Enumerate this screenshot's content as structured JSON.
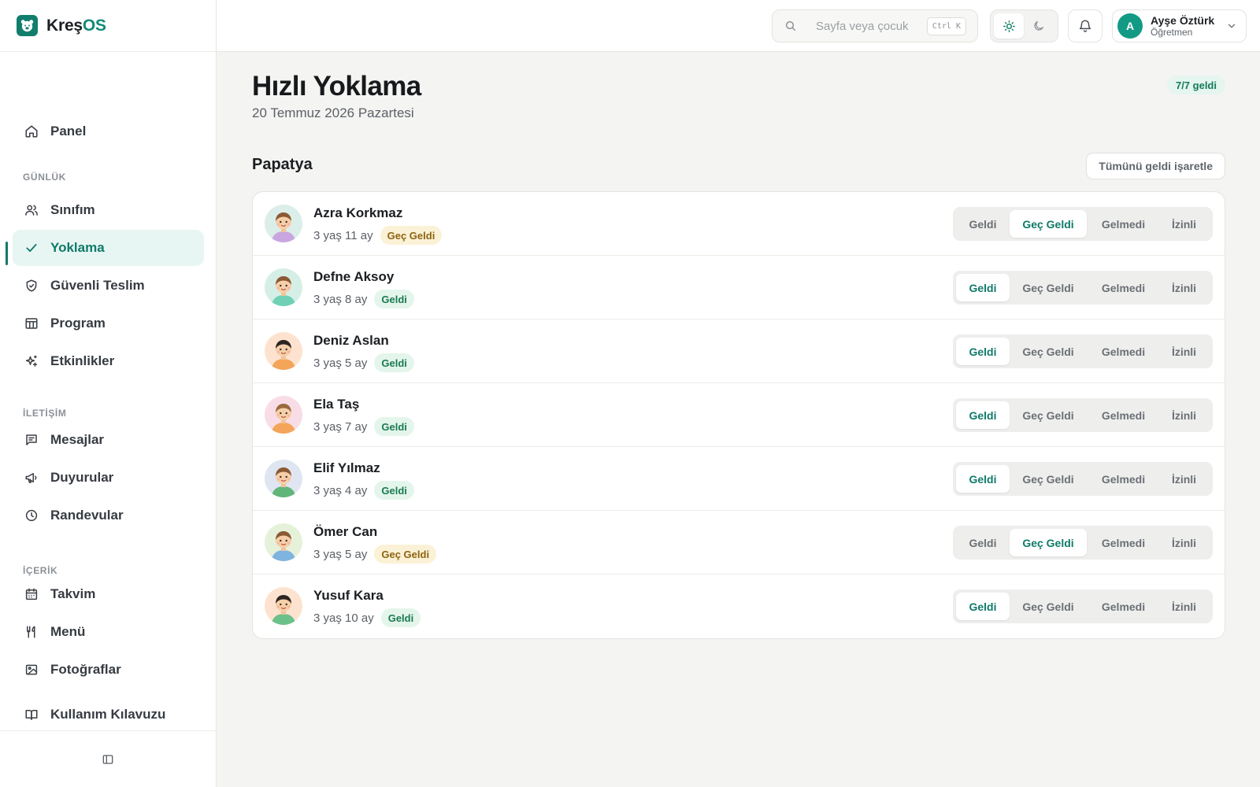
{
  "brand": {
    "name_main": "Kreş",
    "name_accent": "OS",
    "logo_icon": "bear-logo-icon",
    "accent_color": "#117e6d"
  },
  "sidebar": {
    "items": [
      {
        "id": "panel",
        "label": "Panel",
        "icon": "home-icon"
      },
      {
        "id": "sinifim",
        "label": "Sınıfım",
        "icon": "users-icon"
      },
      {
        "id": "yoklama",
        "label": "Yoklama",
        "icon": "check-icon",
        "active": true
      },
      {
        "id": "guvenli-teslim",
        "label": "Güvenli Teslim",
        "icon": "shield-check-icon"
      },
      {
        "id": "program",
        "label": "Program",
        "icon": "table-icon"
      },
      {
        "id": "etkinlikler",
        "label": "Etkinlikler",
        "icon": "sparkle-icon"
      },
      {
        "id": "mesajlar",
        "label": "Mesajlar",
        "icon": "message-icon"
      },
      {
        "id": "duyurular",
        "label": "Duyurular",
        "icon": "megaphone-icon"
      },
      {
        "id": "randevular",
        "label": "Randevular",
        "icon": "clock-icon"
      },
      {
        "id": "takvim",
        "label": "Takvim",
        "icon": "calendar-icon"
      },
      {
        "id": "menu",
        "label": "Menü",
        "icon": "utensils-icon"
      },
      {
        "id": "fotograflar",
        "label": "Fotoğraflar",
        "icon": "image-icon"
      },
      {
        "id": "kilavuz",
        "label": "Kullanım Kılavuzu",
        "icon": "book-icon"
      }
    ],
    "sections": [
      "GÜNLÜK",
      "İLETİŞİM",
      "İÇERİK"
    ],
    "collapse_icon": "sidebar-toggle-icon"
  },
  "topbar": {
    "search_placeholder": "Sayfa veya çocuk",
    "search_shortcut": "Ctrl K",
    "theme": {
      "light_icon": "sun-icon",
      "dark_icon": "moon-icon",
      "selected": "light"
    },
    "notification_icon": "bell-icon",
    "user": {
      "initial": "A",
      "name": "Ayşe Öztürk",
      "role": "Öğretmen"
    }
  },
  "page": {
    "title": "Hızlı Yoklama",
    "date": "20 Temmuz 2026 Pazartesi",
    "summary": "7/7 geldi",
    "class_name": "Papatya",
    "mark_all_label": "Tümünü geldi işaretle"
  },
  "options": [
    "Geldi",
    "Geç Geldi",
    "Gelmedi",
    "İzinli"
  ],
  "children": [
    {
      "name": "Azra Korkmaz",
      "age": "3 yaş 11 ay",
      "status": "Geç Geldi",
      "selected": 1,
      "avatar_bg": "#dbeee9",
      "hair": "#8a5a35",
      "shirt": "#c9a6e0"
    },
    {
      "name": "Defne Aksoy",
      "age": "3 yaş 8 ay",
      "status": "Geldi",
      "selected": 0,
      "avatar_bg": "#d6efe6",
      "hair": "#8a5a35",
      "shirt": "#6fd0b5"
    },
    {
      "name": "Deniz Aslan",
      "age": "3 yaş 5 ay",
      "status": "Geldi",
      "selected": 0,
      "avatar_bg": "#fde3cf",
      "hair": "#2e2520",
      "shirt": "#f3a55a"
    },
    {
      "name": "Ela Taş",
      "age": "3 yaş 7 ay",
      "status": "Geldi",
      "selected": 0,
      "avatar_bg": "#f8dde6",
      "hair": "#9a6a3e",
      "shirt": "#f3a55a"
    },
    {
      "name": "Elif Yılmaz",
      "age": "3 yaş 4 ay",
      "status": "Geldi",
      "selected": 0,
      "avatar_bg": "#dfe6f2",
      "hair": "#8a5a35",
      "shirt": "#62b57a"
    },
    {
      "name": "Ömer Can",
      "age": "3 yaş 5 ay",
      "status": "Geç Geldi",
      "selected": 1,
      "avatar_bg": "#e6f1da",
      "hair": "#8a5a35",
      "shirt": "#7fb3e0"
    },
    {
      "name": "Yusuf Kara",
      "age": "3 yaş 10 ay",
      "status": "Geldi",
      "selected": 0,
      "avatar_bg": "#fde3cf",
      "hair": "#2e2520",
      "shirt": "#6cc08a"
    }
  ]
}
